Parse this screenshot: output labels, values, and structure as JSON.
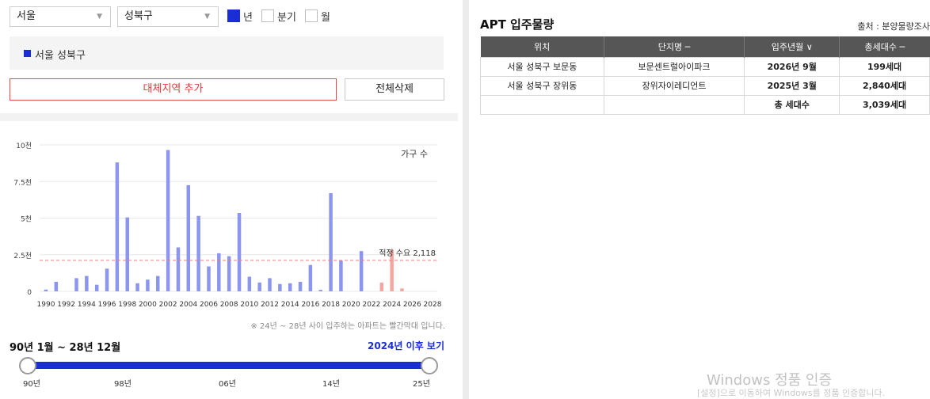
{
  "filters": {
    "city": "서울",
    "district": "성북구",
    "period_options": [
      {
        "label": "년",
        "checked": true
      },
      {
        "label": "분기",
        "checked": false
      },
      {
        "label": "월",
        "checked": false
      }
    ]
  },
  "selected_area": "서울 성북구",
  "buttons": {
    "add_region": "대체지역 추가",
    "delete_all": "전체삭제"
  },
  "chart_data": {
    "type": "bar",
    "legend": "가구 수",
    "y_ticks": [
      "0",
      "2.5천",
      "5천",
      "7.5천",
      "10천"
    ],
    "ylim": [
      0,
      10000
    ],
    "x_tick_labels": [
      "1990",
      "1992",
      "1994",
      "1996",
      "1998",
      "2000",
      "2002",
      "2004",
      "2006",
      "2008",
      "2010",
      "2012",
      "2014",
      "2016",
      "2018",
      "2020",
      "2022",
      "2024",
      "2026",
      "2028"
    ],
    "x_range": [
      1990,
      2028
    ],
    "bars": [
      {
        "x": 1990,
        "y": 120,
        "future": false
      },
      {
        "x": 1991,
        "y": 650,
        "future": false
      },
      {
        "x": 1993,
        "y": 900,
        "future": false
      },
      {
        "x": 1994,
        "y": 1050,
        "future": false
      },
      {
        "x": 1995,
        "y": 450,
        "future": false
      },
      {
        "x": 1996,
        "y": 1550,
        "future": false
      },
      {
        "x": 1997,
        "y": 8800,
        "future": false
      },
      {
        "x": 1998,
        "y": 5050,
        "future": false
      },
      {
        "x": 1999,
        "y": 550,
        "future": false
      },
      {
        "x": 2000,
        "y": 800,
        "future": false
      },
      {
        "x": 2001,
        "y": 1050,
        "future": false
      },
      {
        "x": 2002,
        "y": 9650,
        "future": false
      },
      {
        "x": 2003,
        "y": 3000,
        "future": false
      },
      {
        "x": 2004,
        "y": 7250,
        "future": false
      },
      {
        "x": 2005,
        "y": 5150,
        "future": false
      },
      {
        "x": 2006,
        "y": 1700,
        "future": false
      },
      {
        "x": 2007,
        "y": 2600,
        "future": false
      },
      {
        "x": 2008,
        "y": 2400,
        "future": false
      },
      {
        "x": 2009,
        "y": 5350,
        "future": false
      },
      {
        "x": 2010,
        "y": 1000,
        "future": false
      },
      {
        "x": 2011,
        "y": 600,
        "future": false
      },
      {
        "x": 2012,
        "y": 900,
        "future": false
      },
      {
        "x": 2013,
        "y": 500,
        "future": false
      },
      {
        "x": 2014,
        "y": 550,
        "future": false
      },
      {
        "x": 2015,
        "y": 650,
        "future": false
      },
      {
        "x": 2016,
        "y": 1800,
        "future": false
      },
      {
        "x": 2017,
        "y": 100,
        "future": false
      },
      {
        "x": 2018,
        "y": 6700,
        "future": false
      },
      {
        "x": 2019,
        "y": 2100,
        "future": false
      },
      {
        "x": 2021,
        "y": 2750,
        "future": false
      },
      {
        "x": 2023,
        "y": 600,
        "future": true
      },
      {
        "x": 2024,
        "y": 2840,
        "future": true
      },
      {
        "x": 2025,
        "y": 199,
        "future": true
      }
    ],
    "reference_line": {
      "label": "적정 수요 2,118",
      "value": 2118
    },
    "colors": {
      "bar": "#8c96f0",
      "future_bar": "#f4a6a0",
      "reference": "#ef7f7f"
    }
  },
  "note": "※ 24년 ~ 28년 사이 입주하는 아파트는 빨간막대 입니다.",
  "range": {
    "title": "90년 1월 ~ 28년 12월",
    "after_link": "2024년 이후 보기",
    "ticks": [
      "90년",
      "98년",
      "06년",
      "14년",
      "25년"
    ]
  },
  "apt": {
    "title": "APT 입주물량",
    "source": "출처 : 분양물량조사",
    "headers": [
      "위치",
      "단지명 ─",
      "입주년월 ∨",
      "총세대수 ─"
    ],
    "rows": [
      [
        "서울 성북구 보문동",
        "보문센트럴아이파크",
        "2026년 9월",
        "199세대"
      ],
      [
        "서울 성북구 장위동",
        "장위자이레디언트",
        "2025년 3월",
        "2,840세대"
      ]
    ],
    "total_label": "총 세대수",
    "total_value": "3,039세대"
  },
  "watermark": {
    "line1": "Windows 정품 인증",
    "line2": "[설정]으로 이동하여 Windows를 정품 인증합니다."
  },
  "accent": "#1a2dd6"
}
